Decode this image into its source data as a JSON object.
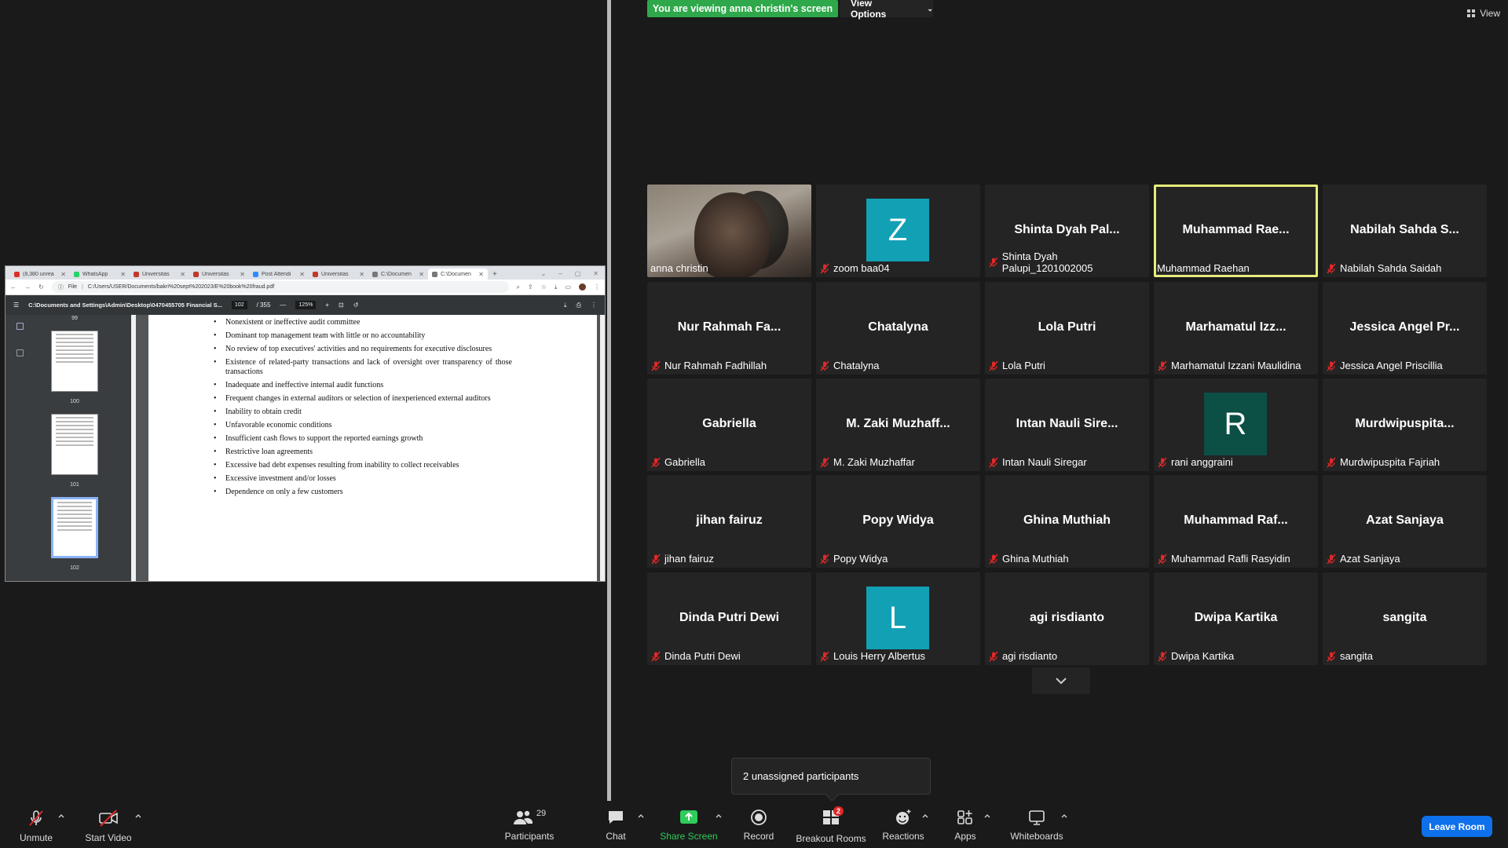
{
  "banner": {
    "viewing": "You are viewing anna christin's screen",
    "view_options": "View Options",
    "view": "View"
  },
  "browser": {
    "tabs": [
      {
        "label": "(8,380 unrea",
        "color": "#d93025"
      },
      {
        "label": "WhatsApp",
        "color": "#25d366"
      },
      {
        "label": "Universitas",
        "color": "#c0392b"
      },
      {
        "label": "Universitas",
        "color": "#c0392b"
      },
      {
        "label": "Post Attendi",
        "color": "#2d8cff"
      },
      {
        "label": "Universitas",
        "color": "#c0392b"
      },
      {
        "label": "C:\\Documen",
        "color": "#777777"
      },
      {
        "label": "C:\\Documen",
        "color": "#777777"
      }
    ],
    "address_prefix": "File",
    "url": "C:/Users/USER/Documents/bakri%20sept%202023/E%20book%20fraud.pdf"
  },
  "pdf": {
    "title": "C:\\Documents and Settings\\Admin\\Desktop\\0470455705 Financial S...",
    "page_current": "102",
    "page_total": "/ 355",
    "zoom": "125%",
    "thumb_nums": [
      "99",
      "100",
      "101",
      "102"
    ],
    "bullets": [
      "Nonexistent or ineffective audit committee",
      "Dominant top management team with little or no accountability",
      "No review of top executives' activities and no requirements for executive disclosures",
      "Existence of related-party transactions and lack of oversight over transparency of those transactions",
      "Inadequate and ineffective internal audit functions",
      "Frequent changes in external auditors or selection of inexperienced external auditors",
      "Inability to obtain credit",
      "Unfavorable economic conditions",
      "Insufficient cash flows to support the reported earnings growth",
      "Restrictive loan agreements",
      "Excessive bad debt expenses resulting from inability to collect receivables",
      "Excessive investment and/or losses",
      "Dependence on only a few customers"
    ]
  },
  "participants": [
    {
      "big": "",
      "label": "anna christin",
      "muted": false,
      "video": true
    },
    {
      "big": "",
      "label": "zoom baa04",
      "muted": true,
      "avatar": "Z",
      "avatar_color": "#12a0b5"
    },
    {
      "big": "Shinta Dyah Pal...",
      "label": "Shinta Dyah Palupi_1201002005",
      "muted": true
    },
    {
      "big": "Muhammad Rae...",
      "label": "Muhammad Raehan",
      "muted": false,
      "active": true
    },
    {
      "big": "Nabilah Sahda S...",
      "label": "Nabilah Sahda Saidah",
      "muted": true
    },
    {
      "big": "Nur Rahmah Fa...",
      "label": "Nur Rahmah Fadhillah",
      "muted": true
    },
    {
      "big": "Chatalyna",
      "label": "Chatalyna",
      "muted": true
    },
    {
      "big": "Lola Putri",
      "label": "Lola Putri",
      "muted": true
    },
    {
      "big": "Marhamatul Izz...",
      "label": "Marhamatul Izzani Maulidina",
      "muted": true
    },
    {
      "big": "Jessica Angel Pr...",
      "label": "Jessica Angel Priscillia",
      "muted": true
    },
    {
      "big": "Gabriella",
      "label": "Gabriella",
      "muted": true
    },
    {
      "big": "M. Zaki Muzhaff...",
      "label": "M. Zaki Muzhaffar",
      "muted": true
    },
    {
      "big": "Intan Nauli Sire...",
      "label": "Intan Nauli Siregar",
      "muted": true
    },
    {
      "big": "",
      "label": "rani anggraini",
      "muted": true,
      "avatar": "R",
      "avatar_color": "#0b4f45"
    },
    {
      "big": "Murdwipuspita...",
      "label": "Murdwipuspita Fajriah",
      "muted": true
    },
    {
      "big": "jihan fairuz",
      "label": "jihan fairuz",
      "muted": true
    },
    {
      "big": "Popy Widya",
      "label": "Popy Widya",
      "muted": true
    },
    {
      "big": "Ghina Muthiah",
      "label": "Ghina Muthiah",
      "muted": true
    },
    {
      "big": "Muhammad Raf...",
      "label": "Muhammad Rafli Rasyidin",
      "muted": true
    },
    {
      "big": "Azat Sanjaya",
      "label": "Azat Sanjaya",
      "muted": true
    },
    {
      "big": "Dinda Putri Dewi",
      "label": "Dinda Putri Dewi",
      "muted": true
    },
    {
      "big": "",
      "label": "Louis Herry Albertus",
      "muted": true,
      "avatar": "L",
      "avatar_color": "#12a0b5"
    },
    {
      "big": "agi risdianto",
      "label": "agi risdianto",
      "muted": true
    },
    {
      "big": "Dwipa Kartika",
      "label": "Dwipa Kartika",
      "muted": true
    },
    {
      "big": "sangita",
      "label": "sangita",
      "muted": true
    }
  ],
  "unassigned": "2 unassigned participants",
  "toolbar": {
    "unmute": "Unmute",
    "start_video": "Start Video",
    "participants": "Participants",
    "participants_count": "29",
    "chat": "Chat",
    "share_screen": "Share Screen",
    "record": "Record",
    "breakout_rooms": "Breakout Rooms",
    "breakout_badge": "2",
    "reactions": "Reactions",
    "apps": "Apps",
    "whiteboards": "Whiteboards",
    "leave": "Leave Room"
  },
  "colors": {
    "share_green": "#2ea84a",
    "leave_blue": "#0e71eb",
    "active_speaker": "#e7eb7a"
  }
}
